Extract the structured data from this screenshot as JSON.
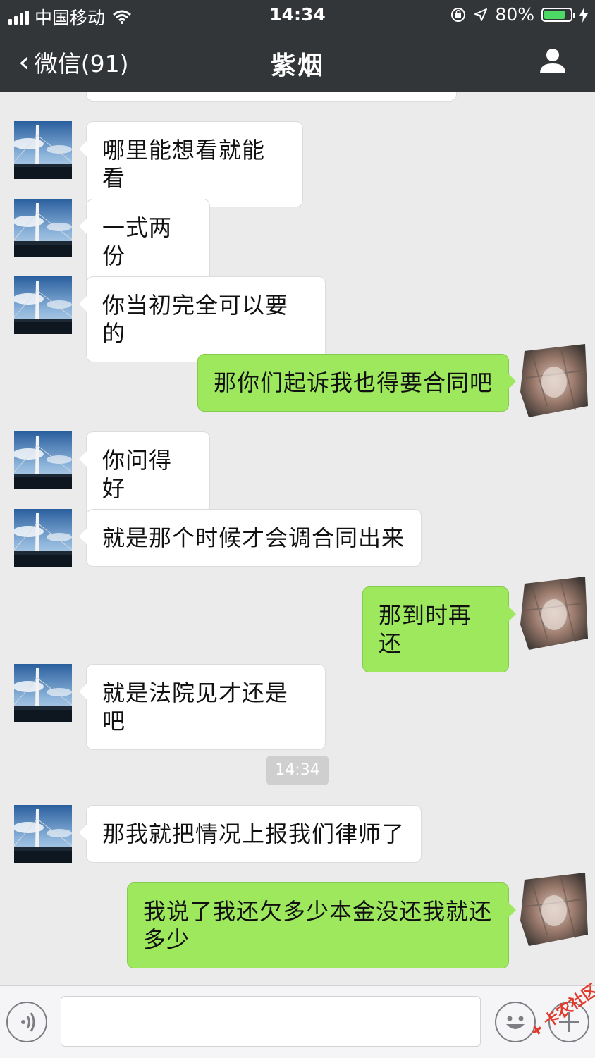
{
  "status_bar": {
    "carrier": "中国移动",
    "time": "14:34",
    "battery": "80%",
    "battery_level": 0.8,
    "icons": [
      "signal-icon",
      "wifi-icon",
      "orientation-lock-icon",
      "location-icon",
      "battery-icon",
      "charging-icon"
    ]
  },
  "nav": {
    "back_label": "微信(91)",
    "title": "紫烟",
    "profile_icon": "person-icon"
  },
  "messages": [
    {
      "side": "left",
      "text": "哪里能想看就能看"
    },
    {
      "side": "left",
      "text": "一式两份"
    },
    {
      "side": "left",
      "text": "你当初完全可以要的"
    },
    {
      "side": "right",
      "text": "那你们起诉我也得要合同吧"
    },
    {
      "side": "left",
      "text": "你问得好"
    },
    {
      "side": "left",
      "text": "就是那个时候才会调合同出来"
    },
    {
      "side": "right",
      "text": "那到时再还"
    },
    {
      "side": "left",
      "text": "就是法院见才还是吧"
    },
    {
      "side": "left",
      "text": "那我就把情况上报我们律师了"
    },
    {
      "side": "right",
      "text": "我说了我还欠多少本金没还我就还多少"
    }
  ],
  "timestamp": "14:34",
  "input_bar": {
    "voice_icon": "voice-icon",
    "emoji_icon": "emoji-icon",
    "plus_icon": "plus-icon",
    "text_value": ""
  },
  "watermark": "卡农社区",
  "colors": {
    "nav_bg": "#333639",
    "chat_bg": "#ebebeb",
    "bubble_self": "#9ee85e",
    "bubble_other": "#ffffff",
    "battery_fill": "#4cd964"
  }
}
